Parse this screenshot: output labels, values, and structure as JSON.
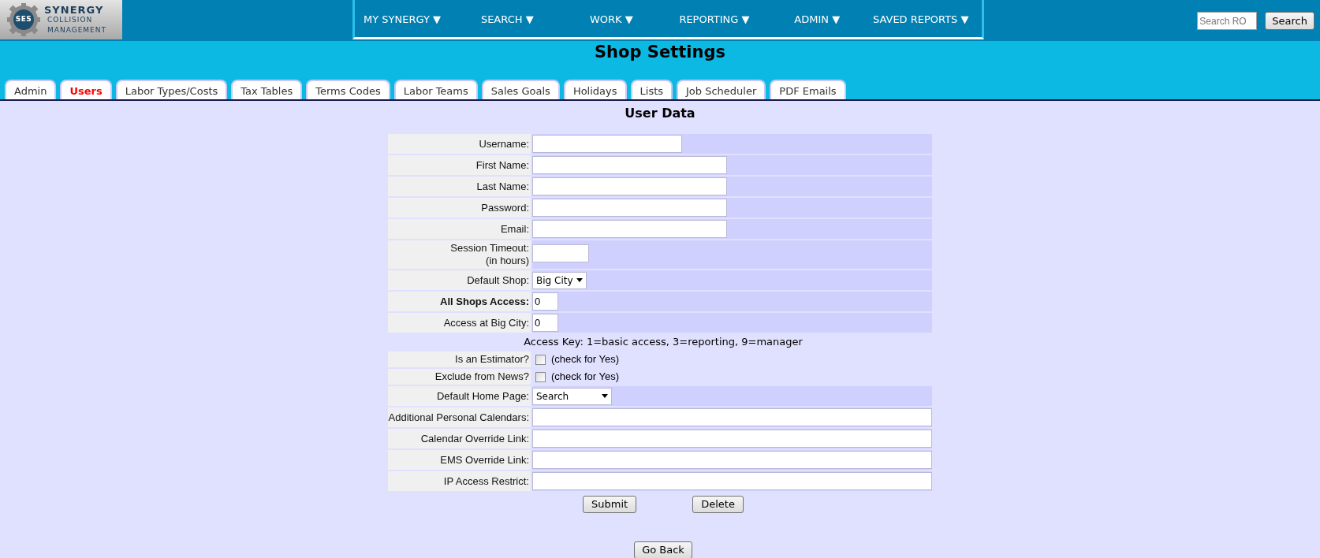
{
  "logo": {
    "badge": "SES",
    "lines": [
      "SYNERGY",
      "COLLISION",
      "MANAGEMENT"
    ]
  },
  "nav": [
    {
      "label": "MY SYNERGY ▼"
    },
    {
      "label": "SEARCH ▼"
    },
    {
      "label": "WORK ▼"
    },
    {
      "label": "REPORTING ▼"
    },
    {
      "label": "ADMIN ▼"
    },
    {
      "label": "SAVED REPORTS ▼"
    }
  ],
  "search": {
    "placeholder": "Search RO",
    "button": "Search"
  },
  "page_title": "Shop Settings",
  "tabs": [
    {
      "label": "Admin",
      "selected": false
    },
    {
      "label": "Users",
      "selected": true
    },
    {
      "label": "Labor Types/Costs",
      "selected": false
    },
    {
      "label": "Tax Tables",
      "selected": false
    },
    {
      "label": "Terms Codes",
      "selected": false
    },
    {
      "label": "Labor Teams",
      "selected": false
    },
    {
      "label": "Sales Goals",
      "selected": false
    },
    {
      "label": "Holidays",
      "selected": false
    },
    {
      "label": "Lists",
      "selected": false
    },
    {
      "label": "Job Scheduler",
      "selected": false
    },
    {
      "label": "PDF Emails",
      "selected": false
    }
  ],
  "section_title": "User Data",
  "form": [
    {
      "kind": "input",
      "label": "Username:"
    },
    {
      "kind": "input",
      "label": "First Name:"
    },
    {
      "kind": "input",
      "label": "Last Name:"
    },
    {
      "kind": "input",
      "label": "Password:"
    },
    {
      "kind": "input",
      "label": "Email:"
    },
    {
      "kind": "input",
      "label": "Session Timeout:",
      "sublabel": "(in hours)"
    },
    {
      "kind": "select",
      "label": "Default Shop:",
      "value": "Big City"
    },
    {
      "kind": "input",
      "label": "All Shops Access:",
      "bold": true,
      "value": "0"
    },
    {
      "kind": "input",
      "label": "Access at Big City:",
      "value": "0"
    },
    {
      "kind": "note",
      "text": "Access Key: 1=basic access, 3=reporting, 9=manager"
    },
    {
      "kind": "checkbox",
      "label": "Is an Estimator?",
      "checked": false,
      "text": "(check for Yes)"
    },
    {
      "kind": "checkbox",
      "label": "Exclude from News?",
      "checked": false,
      "text": "(check for Yes)"
    },
    {
      "kind": "select",
      "label": "Default Home Page:",
      "value": "Search"
    },
    {
      "kind": "input",
      "label": "Additional Personal Calendars:"
    },
    {
      "kind": "input",
      "label": "Calendar Override Link:"
    },
    {
      "kind": "input",
      "label": "EMS Override Link:"
    },
    {
      "kind": "input",
      "label": "IP Access Restrict:"
    }
  ],
  "form_buttons": [
    "Submit",
    "Delete"
  ],
  "back_button": "Go Back"
}
